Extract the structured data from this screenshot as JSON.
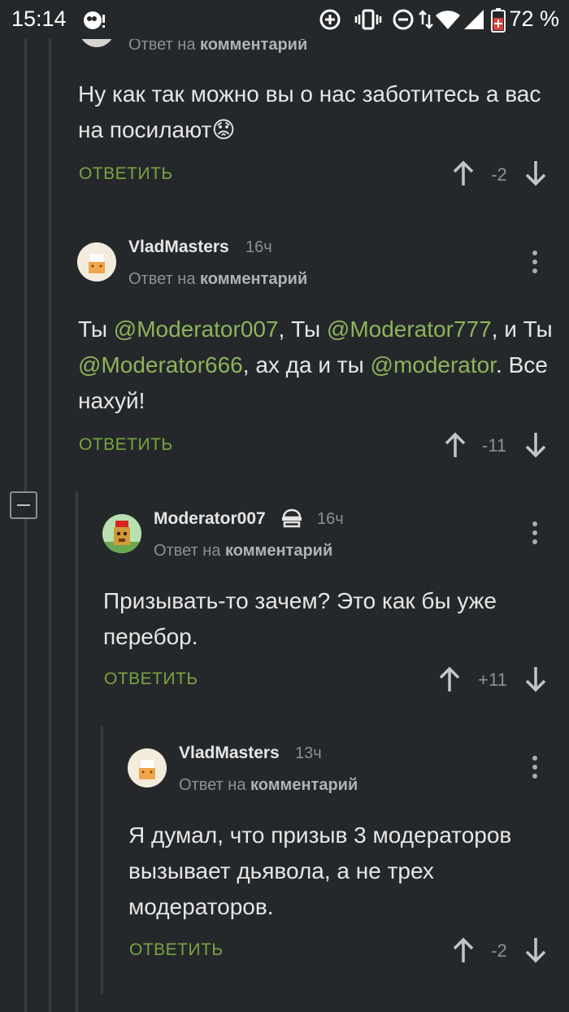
{
  "status_bar": {
    "time": "15:14",
    "battery_percent": "72 %"
  },
  "comments": [
    {
      "reply_prefix": "Ответ на",
      "reply_target": "комментарий",
      "text": "Ну как так можно вы о нас заботитесь а вас на посилают",
      "emoji": "😟",
      "reply_label": "ОТВЕТИТЬ",
      "score": "-2"
    },
    {
      "author": "VladMasters",
      "time": "16ч",
      "reply_prefix": "Ответ на",
      "reply_target": "комментарий",
      "segments": [
        "Ты ",
        "@Moderator007",
        ", Ты ",
        "@Moderator777",
        ", и Ты ",
        "@Moderator666",
        ", ах да и ты ",
        "@moderator",
        ". Все нахуй!"
      ],
      "reply_label": "ОТВЕТИТЬ",
      "score": "-11"
    },
    {
      "author": "Moderator007",
      "badge_icon": "moderator-hat-icon",
      "time": "16ч",
      "reply_prefix": "Ответ на",
      "reply_target": "комментарий",
      "text": "Призывать-то зачем? Это как бы уже перебор.",
      "reply_label": "ОТВЕТИТЬ",
      "score": "+11"
    },
    {
      "author": "VladMasters",
      "time": "13ч",
      "reply_prefix": "Ответ на",
      "reply_target": "комментарий",
      "text": "Я думал, что призыв 3 модераторов вызывает дьявола, а не трех модераторов.",
      "reply_label": "ОТВЕТИТЬ",
      "score": "-2"
    }
  ],
  "colors": {
    "background": "#25282b",
    "accent_green": "#7aa440",
    "mention": "#8fb35b",
    "muted": "#8b9196"
  }
}
